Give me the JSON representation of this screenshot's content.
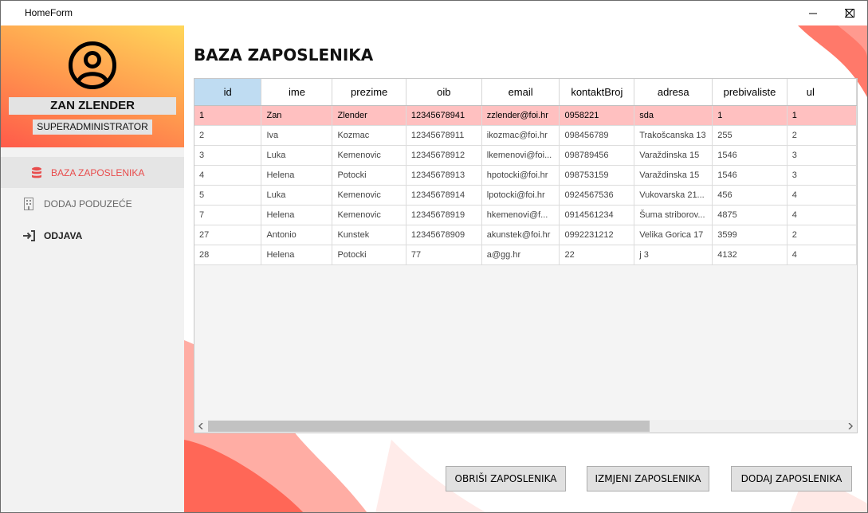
{
  "window": {
    "title": "HomeForm"
  },
  "user": {
    "name": "ZAN ZLENDER",
    "role": "SUPERADMINISTRATOR"
  },
  "nav": [
    {
      "label": "BAZA ZAPOSLENIKA",
      "icon": "database-icon",
      "active": true
    },
    {
      "label": "DODAJ PODUZEĆE",
      "icon": "building-icon",
      "active": false
    },
    {
      "label": "ODJAVA",
      "icon": "sign-out-icon",
      "active": false
    }
  ],
  "page": {
    "title": "BAZA ZAPOSLENIKA"
  },
  "table": {
    "columns": [
      "id",
      "ime",
      "prezime",
      "oib",
      "email",
      "kontaktBroj",
      "adresa",
      "prebivaliste",
      "ul"
    ],
    "rows": [
      [
        "1",
        "Zan",
        "Zlender",
        "12345678941",
        "zzlender@foi.hr",
        "0958221",
        "sda",
        "1",
        "1"
      ],
      [
        "2",
        "Iva",
        "Kozmac",
        "12345678911",
        "ikozmac@foi.hr",
        "098456789",
        "Trakošcanska 13",
        "255",
        "2"
      ],
      [
        "3",
        "Luka",
        "Kemenovic",
        "12345678912",
        "lkemenovi@foi...",
        "098789456",
        "Varaždinska 15",
        "1546",
        "3"
      ],
      [
        "4",
        "Helena",
        "Potocki",
        "12345678913",
        "hpotocki@foi.hr",
        "098753159",
        "Varaždinska 15",
        "1546",
        "3"
      ],
      [
        "5",
        "Luka",
        "Kemenovic",
        "12345678914",
        "lpotocki@foi.hr",
        "0924567536",
        "Vukovarska 21...",
        "456",
        "4"
      ],
      [
        "7",
        "Helena",
        "Kemenovic",
        "12345678919",
        "hkemenovi@f...",
        "0914561234",
        "Šuma striborov...",
        "4875",
        "4"
      ],
      [
        "27",
        "Antonio",
        "Kunstek",
        "12345678909",
        "akunstek@foi.hr",
        "0992231212",
        "Velika Gorica 17",
        "3599",
        "2"
      ],
      [
        "28",
        "Helena",
        "Potocki",
        "77",
        "a@gg.hr",
        "22",
        "j 3",
        "4132",
        "4"
      ]
    ]
  },
  "buttons": {
    "delete": "OBRIŠI ZAPOSLENIKA",
    "edit": "IZMJENI ZAPOSLENIKA",
    "add": "DODAJ ZAPOSLENIKA"
  },
  "colors": {
    "accent": "#e84c4c",
    "highlight_row": "#ffc0c0",
    "selected_header": "#bfdcf2"
  }
}
